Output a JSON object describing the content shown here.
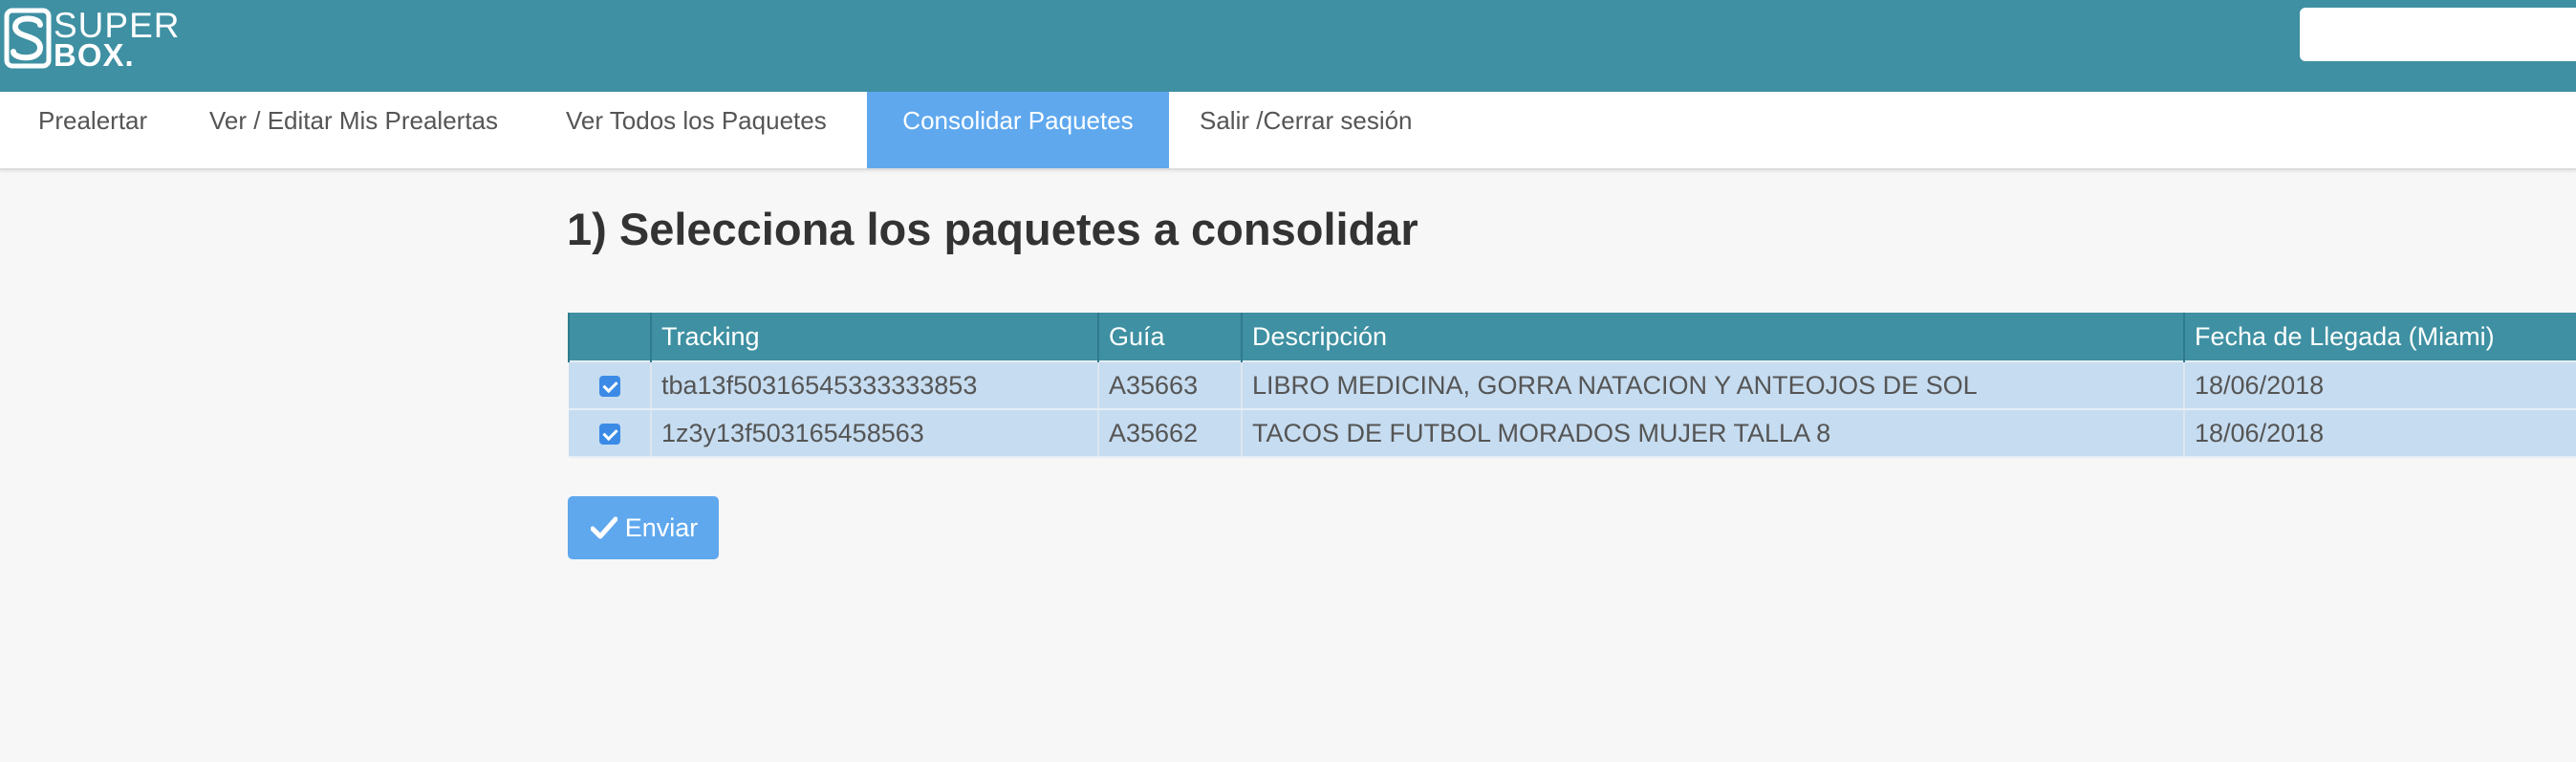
{
  "header": {
    "logo_top": "SUPER",
    "logo_bottom": "BOX.",
    "search_value": ""
  },
  "nav": {
    "items": [
      {
        "label": "Prealertar"
      },
      {
        "label": "Ver / Editar Mis Prealertas"
      },
      {
        "label": "Ver Todos los Paquetes"
      },
      {
        "label": "Consolidar Paquetes",
        "active": true
      },
      {
        "label": "Salir /Cerrar sesión"
      }
    ]
  },
  "main": {
    "title": "1) Selecciona los paquetes a consolidar",
    "table": {
      "headers": [
        "",
        "Tracking",
        "Guía",
        "Descripción",
        "Fecha de Llegada (Miami)"
      ],
      "rows": [
        {
          "checked": true,
          "tracking": "tba13f50316545333333853",
          "guia": "A35663",
          "descripcion": "LIBRO MEDICINA, GORRA NATACION Y ANTEOJOS DE SOL",
          "fecha": "18/06/2018"
        },
        {
          "checked": true,
          "tracking": "1z3y13f503165458563",
          "guia": "A35662",
          "descripcion": "TACOS DE FUTBOL MORADOS MUJER TALLA 8",
          "fecha": "18/06/2018"
        }
      ]
    },
    "submit_label": "Enviar",
    "submit_icon": "check-icon"
  },
  "colors": {
    "header_bg": "#3e90a2",
    "active_tab": "#5fa8ee",
    "row_bg": "#c6dcf0",
    "button_bg": "#5fa8ee"
  }
}
